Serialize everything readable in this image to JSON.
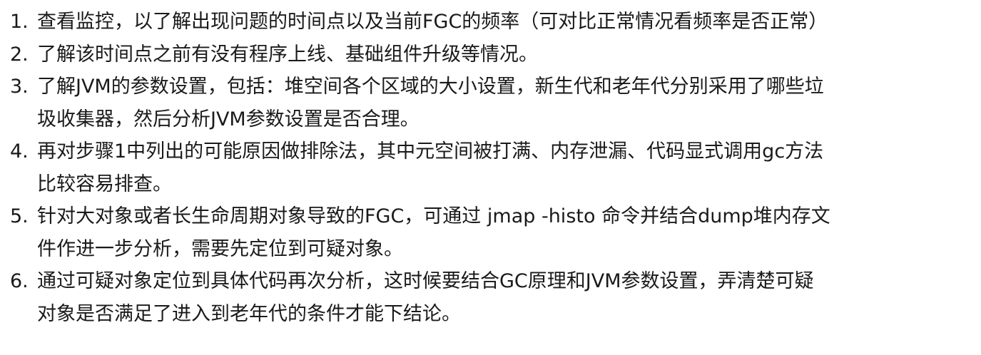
{
  "steps": [
    {
      "number": "1.",
      "lines": [
        "查看监控，以了解出现问题的时间点以及当前FGC的频率（可对比正常情况看频率是否正常）"
      ]
    },
    {
      "number": "2.",
      "lines": [
        "了解该时间点之前有没有程序上线、基础组件升级等情况。"
      ]
    },
    {
      "number": "3.",
      "lines": [
        "了解JVM的参数设置，包括：堆空间各个区域的大小设置，新生代和老年代分别采用了哪些垃",
        "圾收集器，然后分析JVM参数设置是否合理。"
      ]
    },
    {
      "number": "4.",
      "lines": [
        "再对步骤1中列出的可能原因做排除法，其中元空间被打满、内存泄漏、代码显式调用gc方法",
        "比较容易排查。"
      ]
    },
    {
      "number": "5.",
      "lines": [
        "针对大对象或者长生命周期对象导致的FGC，可通过 jmap -histo 命令并结合dump堆内存文",
        "件作进一步分析，需要先定位到可疑对象。"
      ]
    },
    {
      "number": "6.",
      "lines": [
        "通过可疑对象定位到具体代码再次分析，这时候要结合GC原理和JVM参数设置，弄清楚可疑",
        "对象是否满足了进入到老年代的条件才能下结论。"
      ]
    }
  ]
}
